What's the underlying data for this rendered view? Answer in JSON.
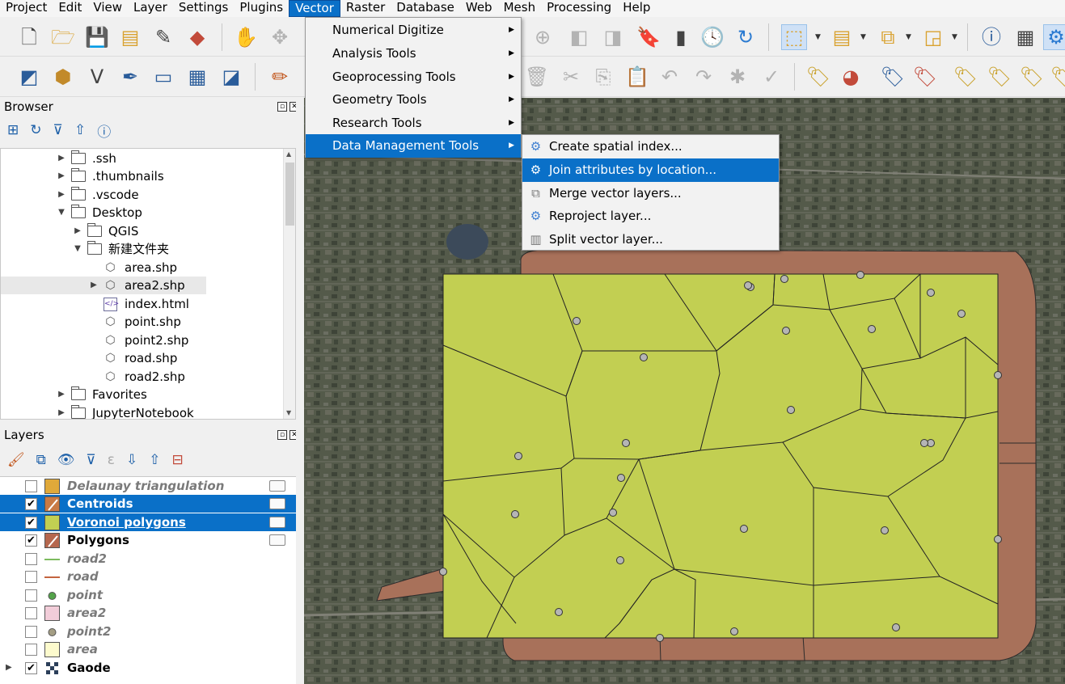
{
  "menubar": {
    "items": [
      "Project",
      "Edit",
      "View",
      "Layer",
      "Settings",
      "Plugins",
      "Vector",
      "Raster",
      "Database",
      "Web",
      "Mesh",
      "Processing",
      "Help"
    ],
    "active": "Vector"
  },
  "vector_menu": {
    "items": [
      {
        "label": "Numerical Digitize"
      },
      {
        "label": "Analysis Tools"
      },
      {
        "label": "Geoprocessing Tools"
      },
      {
        "label": "Geometry Tools"
      },
      {
        "label": "Research Tools"
      },
      {
        "label": "Data Management Tools"
      }
    ],
    "active_index": 5
  },
  "data_management_submenu": {
    "items": [
      {
        "label": "Create spatial index...",
        "icon": "gear-icon"
      },
      {
        "label": "Join attributes by location...",
        "icon": "gear-icon"
      },
      {
        "label": "Merge vector layers...",
        "icon": "merge-layers-icon"
      },
      {
        "label": "Reproject layer...",
        "icon": "gear-icon"
      },
      {
        "label": "Split vector layer...",
        "icon": "split-layer-icon"
      }
    ],
    "active_index": 1
  },
  "browser": {
    "title": "Browser",
    "tree": [
      {
        "label": ".ssh",
        "type": "folder",
        "depth": 0,
        "expander": "collapsed"
      },
      {
        "label": ".thumbnails",
        "type": "folder",
        "depth": 0,
        "expander": "collapsed"
      },
      {
        "label": ".vscode",
        "type": "folder",
        "depth": 0,
        "expander": "collapsed"
      },
      {
        "label": "Desktop",
        "type": "folder",
        "depth": 0,
        "expander": "expanded"
      },
      {
        "label": "QGIS",
        "type": "folder",
        "depth": 1,
        "expander": "collapsed"
      },
      {
        "label": "新建文件夹",
        "type": "folder",
        "depth": 1,
        "expander": "expanded"
      },
      {
        "label": "area.shp",
        "type": "polygon-file",
        "depth": 2,
        "expander": "none"
      },
      {
        "label": "area2.shp",
        "type": "polygon-file",
        "depth": 2,
        "expander": "collapsed",
        "selected": true
      },
      {
        "label": "index.html",
        "type": "html-file",
        "depth": 2,
        "expander": "none"
      },
      {
        "label": "point.shp",
        "type": "polygon-file",
        "depth": 2,
        "expander": "none"
      },
      {
        "label": "point2.shp",
        "type": "polygon-file",
        "depth": 2,
        "expander": "none"
      },
      {
        "label": "road.shp",
        "type": "polygon-file",
        "depth": 2,
        "expander": "none"
      },
      {
        "label": "road2.shp",
        "type": "polygon-file",
        "depth": 2,
        "expander": "none"
      },
      {
        "label": "Favorites",
        "type": "folder",
        "depth": 0,
        "expander": "collapsed"
      },
      {
        "label": "JupyterNotebook",
        "type": "folder",
        "depth": 0,
        "expander": "collapsed"
      }
    ]
  },
  "layers": {
    "title": "Layers",
    "items": [
      {
        "name": "Delaunay triangulation",
        "checked": false,
        "style": "italic",
        "symbol": "fill",
        "color": "#e0a93a",
        "selected": false,
        "renderer": true
      },
      {
        "name": "Centroids",
        "checked": true,
        "style": "bold",
        "symbol": "marker",
        "color": "#c97a45",
        "selected": true,
        "renderer": true
      },
      {
        "name": "Voronoi polygons",
        "checked": true,
        "style": "bold-underline",
        "symbol": "fill",
        "color": "#c2cf52",
        "selected": true,
        "renderer": true
      },
      {
        "name": "Polygons",
        "checked": true,
        "style": "bold",
        "symbol": "marker",
        "color": "#b5674e",
        "selected": false,
        "renderer": true
      },
      {
        "name": "road2",
        "checked": false,
        "style": "italic",
        "symbol": "line",
        "color": "#7dbb5f",
        "selected": false,
        "renderer": false
      },
      {
        "name": "road",
        "checked": false,
        "style": "italic",
        "symbol": "line",
        "color": "#c4643f",
        "selected": false,
        "renderer": false
      },
      {
        "name": "point",
        "checked": false,
        "style": "italic",
        "symbol": "point",
        "color": "#53a34a",
        "selected": false,
        "renderer": false
      },
      {
        "name": "area2",
        "checked": false,
        "style": "italic",
        "symbol": "fill",
        "color": "#f2cdd9",
        "selected": false,
        "renderer": false
      },
      {
        "name": "point2",
        "checked": false,
        "style": "italic",
        "symbol": "point",
        "color": "#a49e84",
        "selected": false,
        "renderer": false
      },
      {
        "name": "area",
        "checked": false,
        "style": "italic",
        "symbol": "fill",
        "color": "#fdfbcd",
        "selected": false,
        "renderer": false
      },
      {
        "name": "Gaode",
        "checked": true,
        "style": "bold",
        "symbol": "raster",
        "color": "#2c3f5a",
        "selected": false,
        "renderer": false,
        "expandable": true
      }
    ]
  },
  "map": {
    "colors": {
      "voronoi_fill": "#c2cf52",
      "outer_polygon_fill": "#a8715a",
      "point_fill": "#b5b5b5",
      "basemap": "#4f5645"
    }
  }
}
